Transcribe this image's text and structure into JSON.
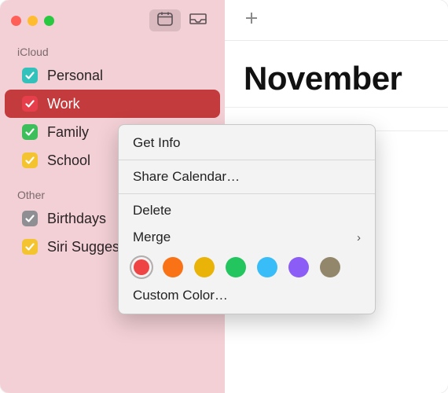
{
  "sidebar": {
    "sections": [
      {
        "title": "iCloud",
        "calendars": [
          {
            "name": "Personal",
            "color": "#32c2bb",
            "checked": true,
            "selected": false
          },
          {
            "name": "Work",
            "color": "#e63e4a",
            "checked": true,
            "selected": true
          },
          {
            "name": "Family",
            "color": "#3cbf5a",
            "checked": true,
            "selected": false
          },
          {
            "name": "School",
            "color": "#f4c430",
            "checked": true,
            "selected": false
          }
        ]
      },
      {
        "title": "Other",
        "calendars": [
          {
            "name": "Birthdays",
            "color": "#8e8e93",
            "checked": true,
            "selected": false
          },
          {
            "name": "Siri Suggestions",
            "color": "#f4c430",
            "checked": true,
            "selected": false
          }
        ]
      }
    ]
  },
  "main": {
    "month_title": "November"
  },
  "context_menu": {
    "items": [
      {
        "label": "Get Info",
        "type": "item"
      },
      {
        "type": "separator"
      },
      {
        "label": "Share Calendar…",
        "type": "item"
      },
      {
        "type": "separator"
      },
      {
        "label": "Delete",
        "type": "item"
      },
      {
        "label": "Merge",
        "type": "submenu"
      },
      {
        "type": "swatches"
      },
      {
        "label": "Custom Color…",
        "type": "item"
      }
    ],
    "swatches": [
      {
        "color": "#ef4444",
        "selected": true
      },
      {
        "color": "#f97316",
        "selected": false
      },
      {
        "color": "#eab308",
        "selected": false
      },
      {
        "color": "#22c55e",
        "selected": false
      },
      {
        "color": "#38bdf8",
        "selected": false
      },
      {
        "color": "#8b5cf6",
        "selected": false
      },
      {
        "color": "#92876a",
        "selected": false
      }
    ]
  }
}
